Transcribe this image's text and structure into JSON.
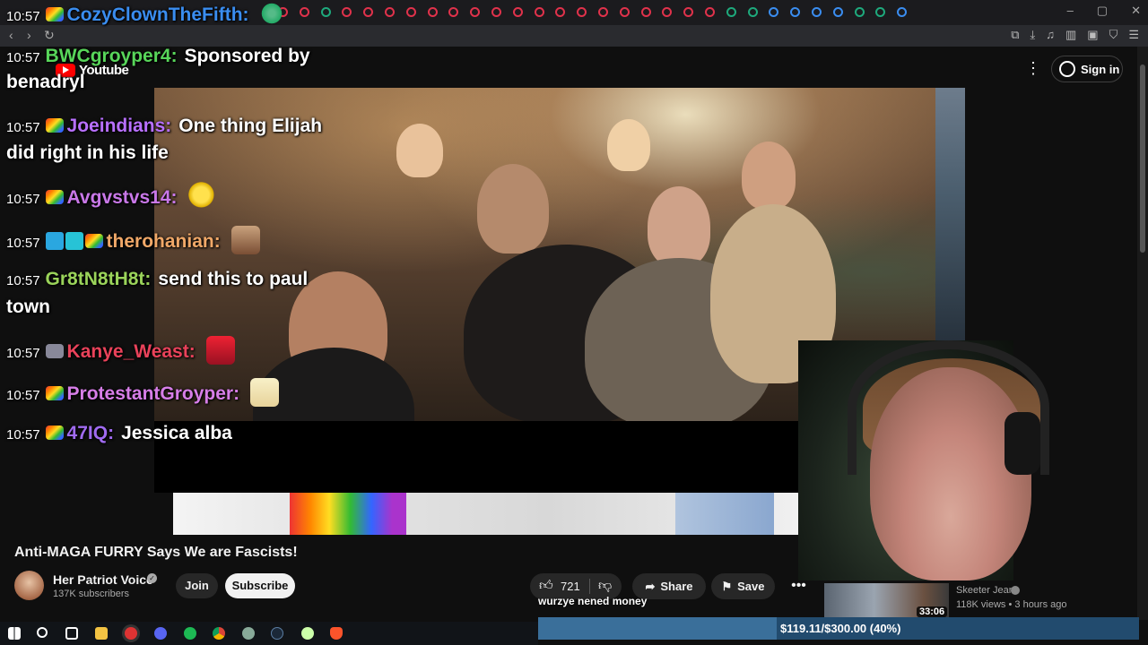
{
  "browser": {
    "window_controls": [
      "–",
      "▢",
      "✕"
    ],
    "extensions": [
      "puzzle-icon",
      "download-icon",
      "media-icon",
      "sidebar-icon",
      "wallet-icon",
      "shield-icon",
      "menu-icon"
    ]
  },
  "youtube": {
    "logo_text": "Youtube",
    "sign_in_label": "Sign in",
    "more_label": "⋮"
  },
  "chat": {
    "messages": [
      {
        "time": "10:57",
        "user": "CozyClownTheFifth:",
        "user_color": "#3a8df0",
        "text": ""
      },
      {
        "time": "10:57",
        "user": "BWCgroyper4:",
        "user_color": "#58d65a",
        "text": "Sponsored by",
        "text_cont": "benadryl"
      },
      {
        "time": "10:57",
        "user": "Joeindians:",
        "user_color": "#b870ff",
        "text": "One thing Elijah",
        "text_cont": "did right in his life"
      },
      {
        "time": "10:57",
        "user": "Avgvstvs14:",
        "user_color": "#c978e8",
        "text": ""
      },
      {
        "time": "10:57",
        "user": "therohanian:",
        "user_color": "#f0a868",
        "text": ""
      },
      {
        "time": "10:57",
        "user": "Gr8tN8tH8t:",
        "user_color": "#9ad35a",
        "text": "send this to paul",
        "text_cont": "town"
      },
      {
        "time": "10:57",
        "user": "Kanye_Weast:",
        "user_color": "#e9425a",
        "text": ""
      },
      {
        "time": "10:57",
        "user": "ProtestantGroyper:",
        "user_color": "#d77ee8",
        "text": ""
      },
      {
        "time": "10:57",
        "user": "47IQ:",
        "user_color": "#a06bf0",
        "text": "Jessica alba"
      }
    ]
  },
  "video": {
    "title": "Anti-MAGA FURRY Says We are Fascists!",
    "channel_name": "Her Patriot Voice",
    "subscribers": "137K subscribers",
    "join_label": "Join",
    "subscribe_label": "Subscribe",
    "likes": "721",
    "share_label": "Share",
    "save_label": "Save",
    "more_label": "•••"
  },
  "overlay": {
    "tts_text": "wurzye nened money"
  },
  "related": {
    "duration": "33:06",
    "channel": "Skeeter Jean",
    "meta": "118K views • 3 hours ago"
  },
  "donation": {
    "label": "$119.11/$300.00 (40%)",
    "raised": 119.11,
    "goal": 300.0
  },
  "taskbar": {
    "apps": [
      "start-icon",
      "search-icon",
      "task-view-icon",
      "file-explorer-icon",
      "app-icon",
      "discord-icon",
      "spotify-icon",
      "chrome-icon",
      "app-icon",
      "steam-icon",
      "app-icon",
      "brave-icon"
    ]
  }
}
